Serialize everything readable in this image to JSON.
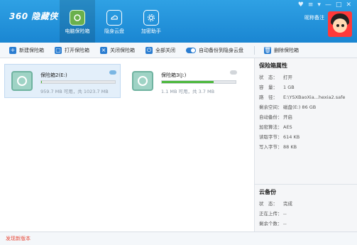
{
  "app": {
    "logo_text": "360 隐藏侠"
  },
  "window_controls": [
    "♥",
    "≡",
    "▾",
    "—",
    "□",
    "✕"
  ],
  "user": {
    "name": "昵称备注"
  },
  "nav": [
    {
      "label": "电脑保险箱",
      "icon": "safe-icon",
      "active": true
    },
    {
      "label": "隐身云盘",
      "icon": "cloud-icon",
      "active": false
    },
    {
      "label": "加密助手",
      "icon": "gear-icon",
      "active": false
    }
  ],
  "toolbar": {
    "new_safe": "新建保险箱",
    "open_safe": "打开保险箱",
    "close_safe": "关闭保险箱",
    "close_all": "全部关闭",
    "auto_backup": "自动备份到隐身云盘",
    "delete_safe": "删除保险箱"
  },
  "safes": [
    {
      "name": "保险箱2(E:)",
      "progress_percent": 1,
      "meta": "959.7 MB 可用，共 1023.7 MB",
      "selected": true
    },
    {
      "name": "保险箱3(J:)",
      "progress_percent": 70,
      "meta": "1.1 MB 可用，共 3.7 MB",
      "selected": false
    }
  ],
  "properties": {
    "title": "保险箱属性",
    "rows": [
      {
        "key": "状　态：",
        "value": "打开"
      },
      {
        "key": "容　量：",
        "value": "1 GB"
      },
      {
        "key": "路　径：",
        "value": "E:\\YSXBaoXia...hexia2.safe"
      },
      {
        "key": "剩余空间：",
        "value": "磁盘(E:) 86 GB"
      },
      {
        "key": "自动备份：",
        "value": "开启"
      },
      {
        "key": "加密算法：",
        "value": "AES"
      },
      {
        "key": "读取字节：",
        "value": "614 KB"
      },
      {
        "key": "写入字节：",
        "value": "88 KB"
      }
    ]
  },
  "cloud_backup": {
    "title": "云备份",
    "rows": [
      {
        "key": "状　态：",
        "value": "完成"
      },
      {
        "key": "正在上传：",
        "value": "--"
      },
      {
        "key": "剩余个数：",
        "value": "--"
      }
    ]
  },
  "footer": {
    "new_version": "发现新版本"
  }
}
